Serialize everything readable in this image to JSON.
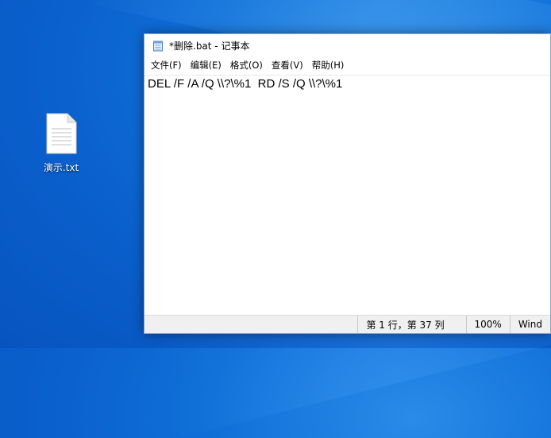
{
  "desktop": {
    "icon_label": "演示.txt",
    "icon_name": "text-file-icon"
  },
  "window": {
    "title": "*删除.bat - 记事本",
    "menu": [
      "文件(F)",
      "编辑(E)",
      "格式(O)",
      "查看(V)",
      "帮助(H)"
    ],
    "content": "DEL /F /A /Q \\\\?\\%1  RD /S /Q \\\\?\\%1",
    "status": {
      "position": "第 1 行，第 37 列",
      "zoom": "100%",
      "line_ending": "Wind"
    }
  }
}
